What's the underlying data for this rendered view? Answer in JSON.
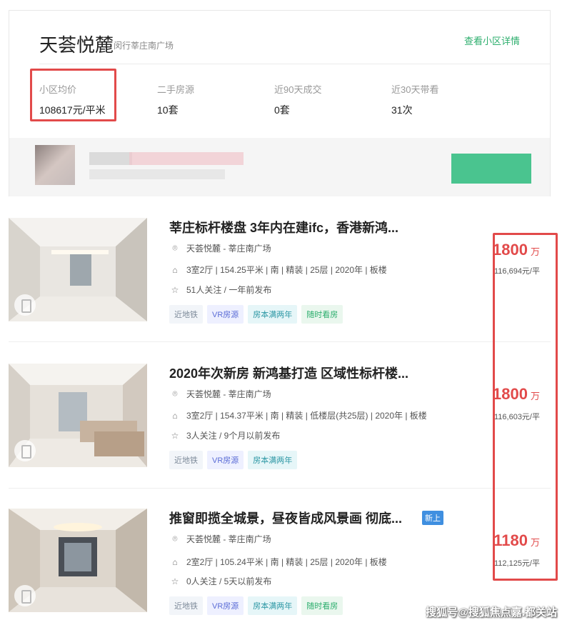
{
  "community": {
    "name": "天荟悦麓",
    "location": "闵行莘庄南广场",
    "detail_link": "查看小区详情",
    "stats": [
      {
        "label": "小区均价",
        "value": "108617元/平米"
      },
      {
        "label": "二手房源",
        "value": "10套"
      },
      {
        "label": "近90天成交",
        "value": "0套"
      },
      {
        "label": "近30天带看",
        "value": "31次"
      }
    ]
  },
  "listings": [
    {
      "title": "莘庄标杆楼盘 3年内在建ifc，香港新鸿...",
      "location": "天荟悦麓 - 莘庄南广场",
      "specs": "3室2厅 | 154.25平米 | 南 | 精装 | 25层 | 2020年 | 板楼",
      "followers": "51人关注 / 一年前发布",
      "tags": [
        "近地铁",
        "VR房源",
        "房本满两年",
        "随时看房"
      ],
      "price": "1800",
      "price_unit": "万",
      "unit_price": "116,694元/平",
      "new_label": ""
    },
    {
      "title": "2020年次新房 新鸿基打造 区域性标杆楼...",
      "location": "天荟悦麓 - 莘庄南广场",
      "specs": "3室2厅 | 154.37平米 | 南 | 精装 | 低楼层(共25层) | 2020年 | 板楼",
      "followers": "3人关注 / 9个月以前发布",
      "tags": [
        "近地铁",
        "VR房源",
        "房本满两年"
      ],
      "price": "1800",
      "price_unit": "万",
      "unit_price": "116,603元/平",
      "new_label": ""
    },
    {
      "title": "推窗即揽全城景，昼夜皆成风景画 彻底...",
      "location": "天荟悦麓 - 莘庄南广场",
      "specs": "2室2厅 | 105.24平米 | 南 | 精装 | 25层 | 2020年 | 板楼",
      "followers": "0人关注 / 5天以前发布",
      "tags": [
        "近地铁",
        "VR房源",
        "房本满两年",
        "随时看房"
      ],
      "price": "1180",
      "price_unit": "万",
      "unit_price": "112,125元/平",
      "new_label": "新上"
    }
  ],
  "icons": {
    "location": "location-pin-icon",
    "house": "house-icon",
    "star": "star-icon",
    "vr": "vr-icon"
  },
  "colors": {
    "accent_green": "#2cae6d",
    "price_red": "#e24a4a",
    "annotation_red": "#e24a4a"
  },
  "watermark": "搜狐号@搜狐焦点嘉.都关站"
}
